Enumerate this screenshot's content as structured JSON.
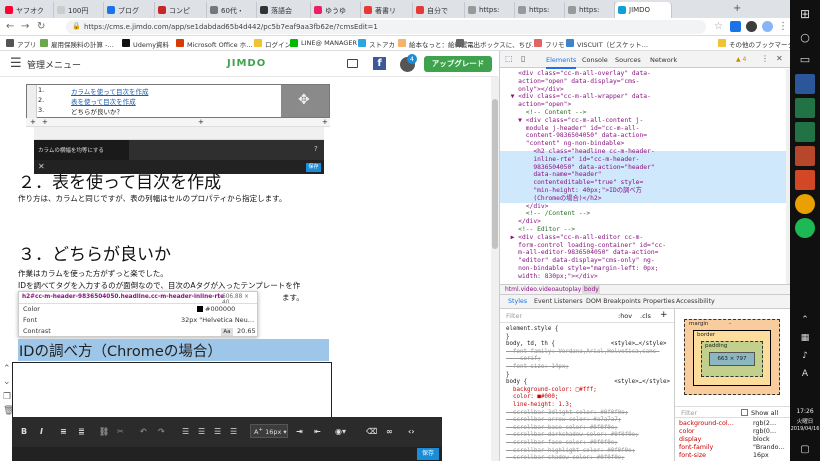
{
  "browser": {
    "tabs": [
      {
        "label": "ヤフオク",
        "color": "#ff0033"
      },
      {
        "label": "100円",
        "color": "#cccccc"
      },
      {
        "label": "ブログ",
        "color": "#1a73e8"
      },
      {
        "label": "コンピ",
        "color": "#c62828"
      },
      {
        "label": "60代・",
        "color": "#777777"
      },
      {
        "label": "落語会",
        "color": "#333333"
      },
      {
        "label": "ゆうゆ",
        "color": "#e91e63"
      },
      {
        "label": "著書リ",
        "color": "#e53935"
      },
      {
        "label": "自分で",
        "color": "#e53935"
      },
      {
        "label": "https:",
        "color": "#999999"
      },
      {
        "label": "https:",
        "color": "#999999"
      },
      {
        "label": "https:",
        "color": "#999999"
      },
      {
        "label": "JIMDO",
        "color": "#0fa0d8"
      }
    ],
    "new_tab": "+",
    "url": "https://cms.e.jimdo.com/app/se1dabdad65b4d442/pc5b7eaf9aa3fb62e/?cmsEdit=1",
    "bookmarks": [
      {
        "label": "アプリ",
        "color": "#555555"
      },
      {
        "label": "雇用保険料の計算 -…",
        "color": "#6aa84f"
      },
      {
        "label": "Udemy資料",
        "color": "#111111"
      },
      {
        "label": "Microsoft Office ホ…",
        "color": "#d83b01"
      },
      {
        "label": "ログイン",
        "color": "#f1c232"
      },
      {
        "label": "LINE@ MANAGER",
        "color": "#00b900"
      },
      {
        "label": "ストアカ",
        "color": "#2ca6de"
      },
      {
        "label": "絵本なっと：絵料置…",
        "color": "#f6b26b"
      },
      {
        "label": "電出ボックスに、ちび…",
        "color": "#666666"
      },
      {
        "label": "フリモ",
        "color": "#e06666"
      },
      {
        "label": "VISCUIT（ビスケット…",
        "color": "#3d85c6"
      }
    ],
    "other_bookmarks": "その他のブックマーク"
  },
  "jimdo": {
    "menu_label": "管理メニュー",
    "logo": "JIMDO",
    "notif_count": "4",
    "upgrade": "アップグレード",
    "editor": {
      "list_items": [
        "カラムを使って目次を作成",
        "表を使って目次を作成",
        "どちらが良いか？"
      ],
      "list_nums": [
        "1.",
        "2.",
        "3."
      ],
      "tooltip_label": "カラムの横幅を均等にする",
      "help": "?",
      "save_mini": "保存"
    },
    "heading2": "２．表を使って目次を作成",
    "para2": "作り方は、カラムと同じですが、表の列幅はセルのプロパティから指定します。",
    "heading3": "３．どちらが良いか",
    "para3a": "作業はカラムを使った方がずっと楽でした。",
    "para3b": "IDを調べてタグを入力するのが面倒なので、目次のAタグが入ったテンプレートを作",
    "para3c": "ます。",
    "inspect": {
      "selector": "h2#cc-m-header-9836504050.headline.cc-m-header-inline-rte",
      "size": "606.88 × 40",
      "rows": [
        {
          "k": "Color",
          "v": "#000000"
        },
        {
          "k": "Font",
          "v": "32px \"Helvetica Neu…"
        },
        {
          "k": "Contrast",
          "v": "20.65"
        }
      ],
      "aa": "Aa"
    },
    "selected_heading": "IDの調べ方（Chromeの場合）",
    "toolbar": {
      "font_size": "16px",
      "save": "保存"
    }
  },
  "devtools": {
    "tabs": [
      "Elements",
      "Console",
      "Sources",
      "Network"
    ],
    "warn_badge": "▲ 4",
    "dom_lines": [
      "    <div class=\"cc-m-all-overlay\" data-",
      "    action=\"open\" data-display=\"cms-",
      "    only\"></div>",
      "  ▼ <div class=\"cc-m-all-wrapper\" data-",
      "    action=\"open\">",
      "      <!-- Content -->",
      "    ▼ <div class=\"cc-m-all-content j-",
      "      module j-header\" id=\"cc-m-all-",
      "      content-9836504050\" data-action=",
      "      \"content\" ng-non-bindable>",
      "        <h2 class=\"headline cc-m-header-",
      "        inline-rte\" id=\"cc-m-header-",
      "        9836504050\" data-action=\"header\"",
      "        data-name=\"header\"",
      "        contenteditable=\"true\" style=",
      "        \"min-height: 40px;\">IDの調べ方",
      "        (Chromeの場合)</h2>",
      "      </div>",
      "      <!-- /Content -->",
      "    </div>",
      "    <!-- Editor -->",
      "  ▶ <div class=\"cc-m-all-editor cc-m-",
      "    form-control loading-container\" id=\"cc-",
      "    m-all-editor-9836504050\" data-action=",
      "    \"editor\" data-display=\"cms-only\" ng-",
      "    non-bindable style=\"margin-left: 0px;",
      "    width: 830px;\"></div>"
    ],
    "breadcrumbs": [
      "html.video.videoautoplay",
      "body"
    ],
    "styles_tabs": [
      "Styles",
      "Event Listeners",
      "DOM Breakpoints",
      "Properties",
      "Accessibility"
    ],
    "filter": "Filter",
    "hov": ":hov",
    "cls": ".cls",
    "css_lines": [
      "element.style {",
      "}",
      "body, td, th {                <style>…</style>",
      "  font-family: Verdana,Arial,Helvetica,sans-",
      "    serif;",
      "  font-size: 14px;",
      "}",
      "body {                         <style>…</style>",
      "  background-color: □#fff;",
      "  color: ■#000;",
      "  line-height: 1.3;",
      "  scrollbar-3dlight-color: #0f0f0e;",
      "  scrollbar-arrow-color: #a7a7a7;",
      "  scrollbar-base-color: #0f0f0e;",
      "  scrollbar-darkshadow-color: #0f0f0e;",
      "  scrollbar-face-color: #0f0f0e;",
      "  scrollbar-highlight-color: #0f0f0e;",
      "  scrollbar-shadow-color: #0f0f0e;"
    ],
    "box": {
      "margin": "margin",
      "border": "border",
      "padding": "padding",
      "content": "663 × 797",
      "dash": "-"
    },
    "comp_filter": "Filter",
    "show_all": "Show all",
    "comp_rows": [
      {
        "k": "background-col…",
        "v": "rgb(2…"
      },
      {
        "k": "color",
        "v": "rgb(0…"
      },
      {
        "k": "display",
        "v": "block"
      },
      {
        "k": "font-family",
        "v": "\"Brando…"
      },
      {
        "k": "font-size",
        "v": "16px"
      }
    ]
  },
  "os": {
    "time": "17:26",
    "day": "火曜日",
    "date": "2019/04/16"
  }
}
